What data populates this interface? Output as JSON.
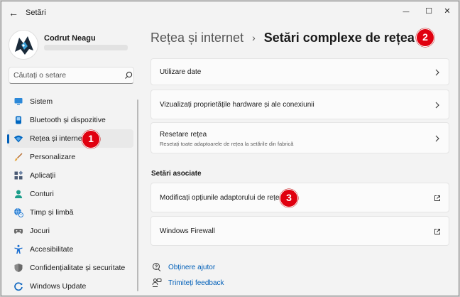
{
  "window": {
    "title": "Setări",
    "back_glyph": "←",
    "min_glyph": "—",
    "max_glyph": "☐",
    "close_glyph": "✕"
  },
  "profile": {
    "name": "Codrut Neagu"
  },
  "search": {
    "placeholder": "Căutați o setare"
  },
  "sidebar": {
    "items": [
      {
        "label": "Sistem",
        "icon": "monitor-icon",
        "color": "#0078d4"
      },
      {
        "label": "Bluetooth și dispozitive",
        "icon": "bluetooth-icon",
        "color": "#0067c0"
      },
      {
        "label": "Rețea și internet",
        "icon": "wifi-icon",
        "color": "#0067c0",
        "active": true
      },
      {
        "label": "Personalizare",
        "icon": "brush-icon",
        "color": "#d08a2b"
      },
      {
        "label": "Aplicații",
        "icon": "apps-icon",
        "color": "#4a5a73"
      },
      {
        "label": "Conturi",
        "icon": "person-icon",
        "color": "#1b9d8a"
      },
      {
        "label": "Timp și limbă",
        "icon": "globe-clock-icon",
        "color": "#2d7fd1"
      },
      {
        "label": "Jocuri",
        "icon": "gamepad-icon",
        "color": "#6b6b6b"
      },
      {
        "label": "Accesibilitate",
        "icon": "accessibility-icon",
        "color": "#1c6fd1"
      },
      {
        "label": "Confidențialitate și securitate",
        "icon": "shield-icon",
        "color": "#7d7d7d"
      },
      {
        "label": "Windows Update",
        "icon": "update-icon",
        "color": "#1067c0"
      }
    ]
  },
  "breadcrumb": {
    "parent": "Rețea și internet",
    "separator": "›",
    "current": "Setări complexe de rețea"
  },
  "cards": {
    "data_usage": "Utilizare date",
    "hardware": "Vizualizați proprietățile hardware și ale conexiunii",
    "reset_title": "Resetare rețea",
    "reset_sub": "Resetați toate adaptoarele de rețea la setările din fabrică"
  },
  "related": {
    "title": "Setări asociate",
    "adapter": "Modificați opțiunile adaptorului de rețea",
    "firewall": "Windows Firewall"
  },
  "links": {
    "help": "Obținere ajutor",
    "feedback": "Trimiteți feedback"
  },
  "badges": [
    "1",
    "2",
    "3"
  ],
  "colors": {
    "accent": "#005fb8",
    "badge": "#e0000f",
    "link": "#005fb8"
  }
}
